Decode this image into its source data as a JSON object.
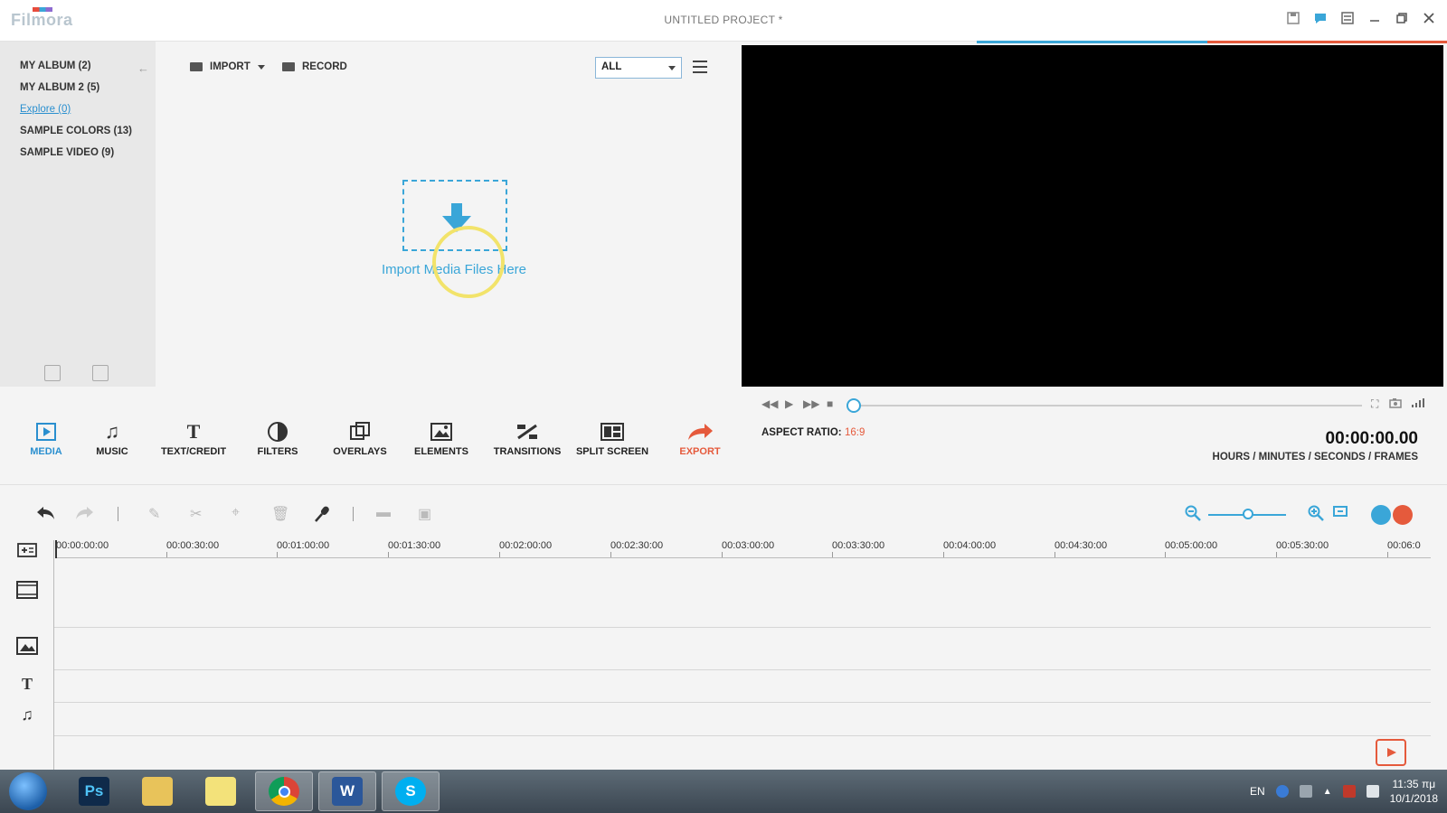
{
  "app": {
    "logo": "Filmora",
    "project_title": "UNTITLED PROJECT *"
  },
  "sidebar": {
    "items": [
      {
        "label": "MY ALBUM (2)"
      },
      {
        "label": "MY ALBUM 2 (5)"
      },
      {
        "label": "Explore (0)"
      },
      {
        "label": "SAMPLE COLORS (13)"
      },
      {
        "label": "SAMPLE VIDEO (9)"
      }
    ]
  },
  "media": {
    "import_label": "IMPORT",
    "record_label": "RECORD",
    "filter_value": "ALL",
    "drop_text": "Import Media Files Here"
  },
  "tools": [
    {
      "label": "MEDIA",
      "icon": "media-icon"
    },
    {
      "label": "MUSIC",
      "icon": "music-icon"
    },
    {
      "label": "TEXT/CREDIT",
      "icon": "text-icon"
    },
    {
      "label": "FILTERS",
      "icon": "filters-icon"
    },
    {
      "label": "OVERLAYS",
      "icon": "overlays-icon"
    },
    {
      "label": "ELEMENTS",
      "icon": "elements-icon"
    },
    {
      "label": "TRANSITIONS",
      "icon": "transitions-icon"
    },
    {
      "label": "SPLIT SCREEN",
      "icon": "split-screen-icon"
    },
    {
      "label": "EXPORT",
      "icon": "export-icon"
    }
  ],
  "player": {
    "aspect_label": "ASPECT RATIO:",
    "aspect_value": "16:9",
    "timecode": "00:00:00.00",
    "timecode_caption": "HOURS / MINUTES / SECONDS / FRAMES"
  },
  "ruler": {
    "labels": [
      "00:00:00:00",
      "00:00:30:00",
      "00:01:00:00",
      "00:01:30:00",
      "00:02:00:00",
      "00:02:30:00",
      "00:03:00:00",
      "00:03:30:00",
      "00:04:00:00",
      "00:04:30:00",
      "00:05:00:00",
      "00:05:30:00",
      "00:06:0"
    ]
  },
  "taskbar": {
    "language": "EN",
    "time": "11:35 πμ",
    "date": "10/1/2018",
    "apps": [
      "photoshop-app",
      "file-explorer-app",
      "sticky-notes-app",
      "chrome-app",
      "word-app",
      "skype-app"
    ]
  },
  "colors": {
    "accent": "#3aa6d8",
    "export": "#e55a3c",
    "preview_bg": "#000000"
  }
}
